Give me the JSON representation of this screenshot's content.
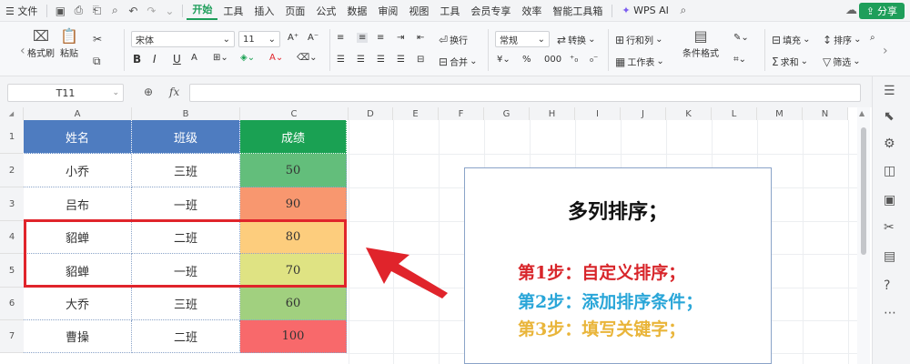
{
  "menubar": {
    "menu_icon": "☰",
    "file": "文件",
    "tabs": [
      "开始",
      "工具",
      "插入",
      "页面",
      "公式",
      "数据",
      "审阅",
      "视图",
      "工具",
      "会员专享",
      "效率",
      "智能工具箱"
    ],
    "active_tab": "开始",
    "wps_ai": "WPS AI",
    "share": "分享"
  },
  "ribbon": {
    "format_painter": "格式刷",
    "paste": "粘贴",
    "font_name": "宋体",
    "font_size": "11",
    "bold": "B",
    "italic": "I",
    "underline": "U",
    "wrap": "换行",
    "merge": "合并",
    "number_format": "常规",
    "convert": "转换",
    "rows_cols": "行和列",
    "worksheet": "工作表",
    "cond_format": "条件格式",
    "fill": "填充",
    "sort": "排序",
    "sum": "求和",
    "filter": "筛选"
  },
  "formula_bar": {
    "cell_ref": "T11",
    "fx": "fx",
    "value": ""
  },
  "sheet": {
    "columns": [
      "A",
      "B",
      "C",
      "D",
      "E",
      "F",
      "G",
      "H",
      "I",
      "J",
      "K",
      "L",
      "M",
      "N"
    ],
    "rows": [
      "1",
      "2",
      "3",
      "4",
      "5",
      "6",
      "7"
    ],
    "header": {
      "name": "姓名",
      "class": "班级",
      "score": "成绩"
    },
    "records": [
      {
        "name": "小乔",
        "class": "三班",
        "score": "50",
        "color": "#63be7b"
      },
      {
        "name": "吕布",
        "class": "一班",
        "score": "90",
        "color": "#f8976f"
      },
      {
        "name": "貂蝉",
        "class": "二班",
        "score": "80",
        "color": "#fdcd7d"
      },
      {
        "name": "貂蝉",
        "class": "一班",
        "score": "70",
        "color": "#dfe383"
      },
      {
        "name": "大乔",
        "class": "三班",
        "score": "60",
        "color": "#a1d07f"
      },
      {
        "name": "曹操",
        "class": "二班",
        "score": "100",
        "color": "#f8696b"
      }
    ],
    "header_colors": {
      "name": "#4e7cc0",
      "class": "#4e7cc0",
      "score": "#1aa153"
    }
  },
  "note": {
    "title": "多列排序；",
    "steps": [
      {
        "text": "第1步：自定义排序；",
        "color": "#d8262b"
      },
      {
        "text": "第2步：添加排序条件；",
        "color": "#2aa6d8"
      },
      {
        "text": "第3步：填写关键字；",
        "color": "#e9b53a"
      }
    ]
  },
  "colors": {
    "accent": "#1e9e5a",
    "highlight_border": "#e0242b"
  }
}
